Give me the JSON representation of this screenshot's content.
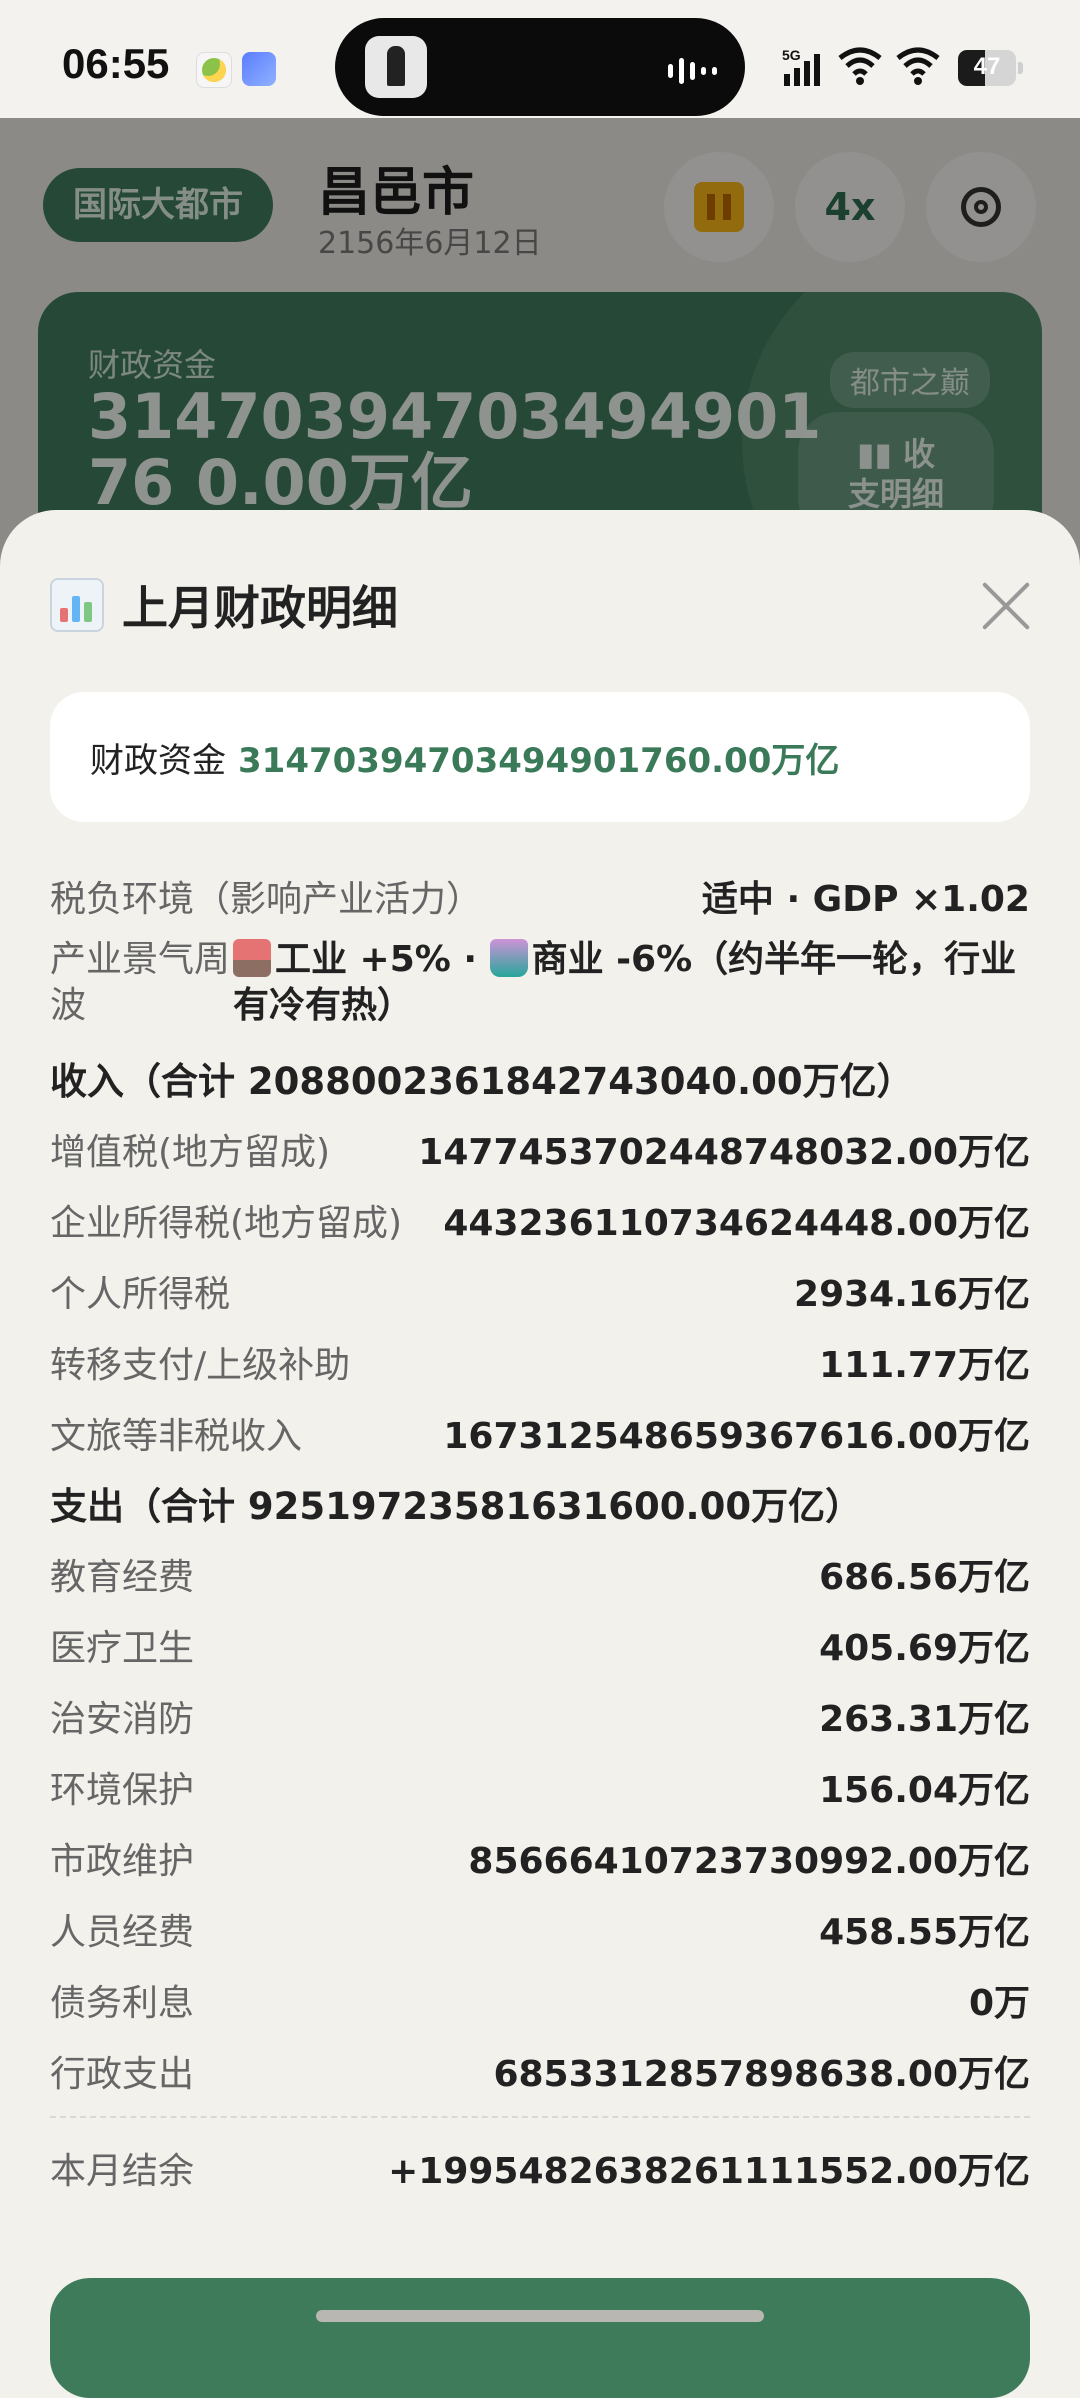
{
  "status_bar": {
    "time": "06:55",
    "network": "5G",
    "battery": "47",
    "battery_level": 0.47
  },
  "background": {
    "city_badge": "国际大都市",
    "city_name": "昌邑市",
    "date": "2156年6月12日",
    "speed": "4x",
    "fund_label": "财政资金",
    "fund_value": "3147039470349490176 0.00万亿",
    "peak_badge": "都市之巅",
    "detail_button_line1": "收",
    "detail_button_line2": "支明细"
  },
  "sheet": {
    "title": "上月财政明细",
    "fund_box": {
      "label": "财政资金",
      "value": "31470394703494901760.00万亿"
    },
    "tax_env": {
      "label": "税负环境（影响产业活力）",
      "value": "适中 · GDP ×1.02"
    },
    "cycle": {
      "label": "产业景气周波",
      "industry": "工业 +5%",
      "sep": " · ",
      "commerce": "商业 -6%（约半年一轮，行业有冷有热）"
    },
    "income": {
      "title": "收入（合计 2088002361842743040.00万亿）",
      "items": [
        {
          "label": "增值税(地方留成)",
          "value": "1477453702448748032.00万亿"
        },
        {
          "label": "企业所得税(地方留成)",
          "value": "443236110734624448.00万亿"
        },
        {
          "label": "个人所得税",
          "value": "2934.16万亿"
        },
        {
          "label": "转移支付/上级补助",
          "value": "111.77万亿"
        },
        {
          "label": "文旅等非税收入",
          "value": "167312548659367616.00万亿"
        }
      ]
    },
    "expense": {
      "title": "支出（合计 92519723581631600.00万亿）",
      "items": [
        {
          "label": "教育经费",
          "value": "686.56万亿"
        },
        {
          "label": "医疗卫生",
          "value": "405.69万亿"
        },
        {
          "label": "治安消防",
          "value": "263.31万亿"
        },
        {
          "label": "环境保护",
          "value": "156.04万亿"
        },
        {
          "label": "市政维护",
          "value": "85666410723730992.00万亿"
        },
        {
          "label": "人员经费",
          "value": "458.55万亿"
        },
        {
          "label": "债务利息",
          "value": "0万"
        },
        {
          "label": "行政支出",
          "value": "6853312857898638.00万亿"
        }
      ]
    },
    "balance": {
      "label": "本月结余",
      "value": "+1995482638261111552.00万亿"
    }
  },
  "colors": {
    "accent_green": "#3e7b5b",
    "value_green": "#3a7a58",
    "pause_orange": "#f6b21a"
  },
  "icons": {
    "title_icon": "bar-chart-icon",
    "close": "close-icon",
    "industry": "factory-icon",
    "commerce": "shopping-bags-icon"
  }
}
